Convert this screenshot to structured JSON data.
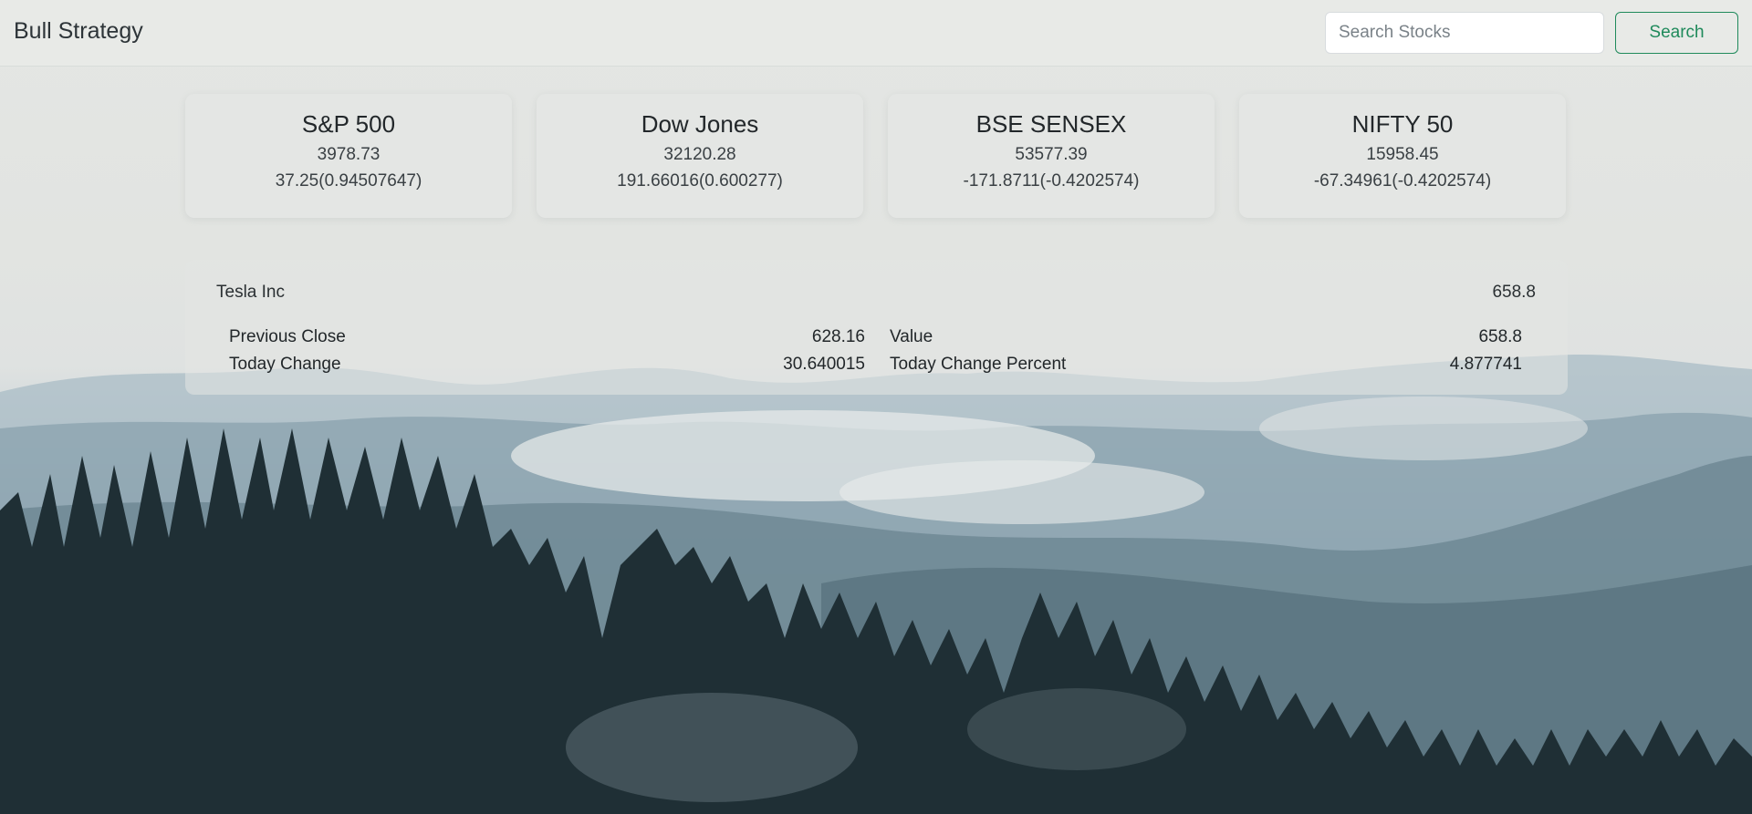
{
  "navbar": {
    "brand": "Bull Strategy",
    "search_placeholder": "Search Stocks",
    "search_value": "",
    "search_button": "Search"
  },
  "indices": [
    {
      "name": "S&P 500",
      "value": "3978.73",
      "change": "37.25(0.94507647)"
    },
    {
      "name": "Dow Jones",
      "value": "32120.28",
      "change": "191.66016(0.600277)"
    },
    {
      "name": "BSE SENSEX",
      "value": "53577.39",
      "change": "-171.8711(-0.4202574)"
    },
    {
      "name": "NIFTY 50",
      "value": "15958.45",
      "change": "-67.34961(-0.4202574)"
    }
  ],
  "stock": {
    "name": "Tesla Inc",
    "price": "658.8",
    "details": {
      "previous_close_label": "Previous Close",
      "previous_close": "628.16",
      "today_change_label": "Today Change",
      "today_change": "30.640015",
      "value_label": "Value",
      "value": "658.8",
      "today_change_percent_label": "Today Change Percent",
      "today_change_percent": "4.877741"
    }
  },
  "colors": {
    "accent": "#1f8a5b",
    "text": "#2b3033"
  }
}
